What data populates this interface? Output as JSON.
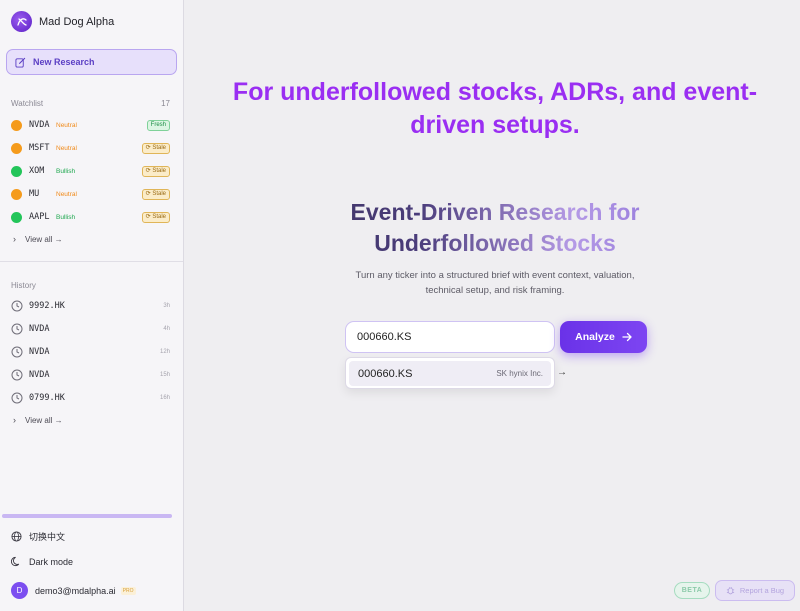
{
  "app": {
    "name": "Mad Dog Alpha"
  },
  "sidebar": {
    "new_research_label": "New Research",
    "watchlist": {
      "label": "Watchlist",
      "count": "17",
      "items": [
        {
          "ticker": "NVDA",
          "sentiment": "Neutral",
          "badge": "Fresh",
          "dot_color": "#f59b1c"
        },
        {
          "ticker": "MSFT",
          "sentiment": "Neutral",
          "badge": "⟳ Stale",
          "dot_color": "#f59b1c"
        },
        {
          "ticker": "XOM",
          "sentiment": "Bullish",
          "badge": "⟳ Stale",
          "dot_color": "#23c55a"
        },
        {
          "ticker": "MU",
          "sentiment": "Neutral",
          "badge": "⟳ Stale",
          "dot_color": "#f59b1c"
        },
        {
          "ticker": "AAPL",
          "sentiment": "Bullish",
          "badge": "⟳ Stale",
          "dot_color": "#23c55a"
        }
      ],
      "view_all": "View all →"
    },
    "history": {
      "label": "History",
      "items": [
        {
          "ticker": "9992.HK",
          "time": "3h"
        },
        {
          "ticker": "NVDA",
          "time": "4h"
        },
        {
          "ticker": "NVDA",
          "time": "12h"
        },
        {
          "ticker": "NVDA",
          "time": "15h"
        },
        {
          "ticker": "0799.HK",
          "time": "16h"
        }
      ],
      "view_all": "View all →"
    },
    "language_label": "切换中文",
    "dark_mode_label": "Dark mode",
    "user": {
      "initial": "D",
      "email": "demo3@mdalpha.ai",
      "plan": "PRO"
    }
  },
  "main": {
    "hero_text": "For underfollowed stocks, ADRs, and event-driven setups.",
    "title": "Event-Driven Research for Underfollowed Stocks",
    "subtitle": "Turn any ticker into a structured brief with event context, valuation, technical setup, and risk framing.",
    "search": {
      "value": "000660.KS",
      "button_label": "Analyze"
    },
    "suggestion": {
      "ticker": "000660.KS",
      "name": "SK hynix Inc.",
      "arrow": "→"
    }
  },
  "footer": {
    "beta_label": "BETA",
    "report_bug_label": "Report a Bug"
  },
  "colors": {
    "accent": "#7d45f2",
    "hero": "#9a2ef2",
    "neutral": "#f08a1a",
    "bullish": "#1fa84f"
  }
}
